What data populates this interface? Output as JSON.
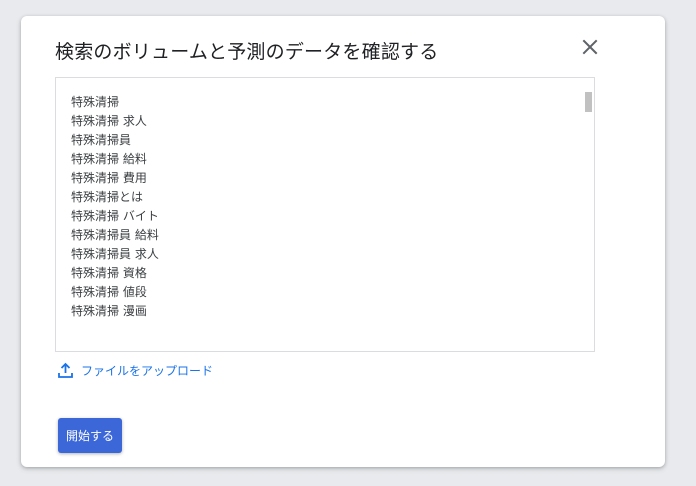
{
  "dialog": {
    "title": "検索のボリュームと予測のデータを確認する",
    "close_icon": "close-icon"
  },
  "keywords": {
    "items": [
      "特殊清掃",
      "特殊清掃 求人",
      "特殊清掃員",
      "特殊清掃 給料",
      "特殊清掃 費用",
      "特殊清掃とは",
      "特殊清掃 バイト",
      "特殊清掃員 給料",
      "特殊清掃員 求人",
      "特殊清掃 資格",
      "特殊清掃 値段",
      "特殊清掃 漫画"
    ]
  },
  "upload": {
    "icon": "upload-icon",
    "label": "ファイルをアップロード"
  },
  "actions": {
    "start_label": "開始する"
  },
  "colors": {
    "accent": "#1a73e8",
    "button": "#3b67d8",
    "background": "#e8eaed"
  }
}
